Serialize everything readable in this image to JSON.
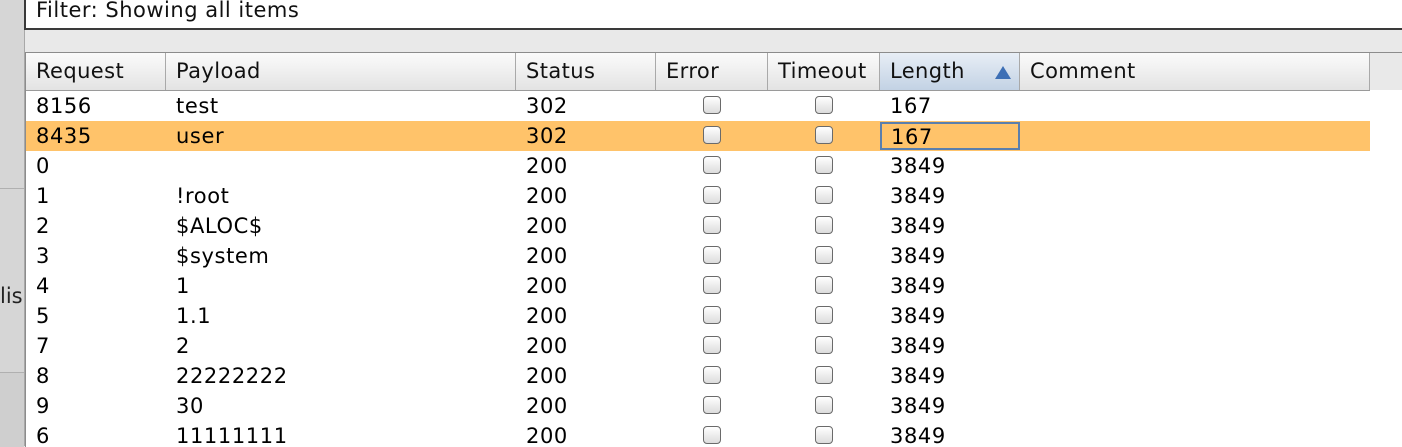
{
  "left_panel": {
    "label": "lis"
  },
  "filter": {
    "text": "Filter: Showing all items"
  },
  "table": {
    "columns": [
      {
        "key": "request",
        "label": "Request"
      },
      {
        "key": "payload",
        "label": "Payload"
      },
      {
        "key": "status",
        "label": "Status"
      },
      {
        "key": "error",
        "label": "Error"
      },
      {
        "key": "timeout",
        "label": "Timeout"
      },
      {
        "key": "length",
        "label": "Length",
        "sorted": "ascending"
      },
      {
        "key": "comment",
        "label": "Comment"
      }
    ],
    "selected_row_color": "#ffc36a",
    "rows": [
      {
        "request": "8156",
        "payload": "test",
        "status": "302",
        "error": false,
        "timeout": false,
        "length": "167",
        "comment": ""
      },
      {
        "request": "8435",
        "payload": "user",
        "status": "302",
        "error": false,
        "timeout": false,
        "length": "167",
        "comment": "",
        "selected": true
      },
      {
        "request": "0",
        "payload": "",
        "status": "200",
        "error": false,
        "timeout": false,
        "length": "3849",
        "comment": ""
      },
      {
        "request": "1",
        "payload": "!root",
        "status": "200",
        "error": false,
        "timeout": false,
        "length": "3849",
        "comment": ""
      },
      {
        "request": "2",
        "payload": "$ALOC$",
        "status": "200",
        "error": false,
        "timeout": false,
        "length": "3849",
        "comment": ""
      },
      {
        "request": "3",
        "payload": "$system",
        "status": "200",
        "error": false,
        "timeout": false,
        "length": "3849",
        "comment": ""
      },
      {
        "request": "4",
        "payload": "1",
        "status": "200",
        "error": false,
        "timeout": false,
        "length": "3849",
        "comment": ""
      },
      {
        "request": "5",
        "payload": "1.1",
        "status": "200",
        "error": false,
        "timeout": false,
        "length": "3849",
        "comment": ""
      },
      {
        "request": "7",
        "payload": "2",
        "status": "200",
        "error": false,
        "timeout": false,
        "length": "3849",
        "comment": ""
      },
      {
        "request": "8",
        "payload": "22222222",
        "status": "200",
        "error": false,
        "timeout": false,
        "length": "3849",
        "comment": ""
      },
      {
        "request": "9",
        "payload": "30",
        "status": "200",
        "error": false,
        "timeout": false,
        "length": "3849",
        "comment": ""
      },
      {
        "request": "6",
        "payload": "11111111",
        "status": "200",
        "error": false,
        "timeout": false,
        "length": "3849",
        "comment": ""
      }
    ]
  }
}
